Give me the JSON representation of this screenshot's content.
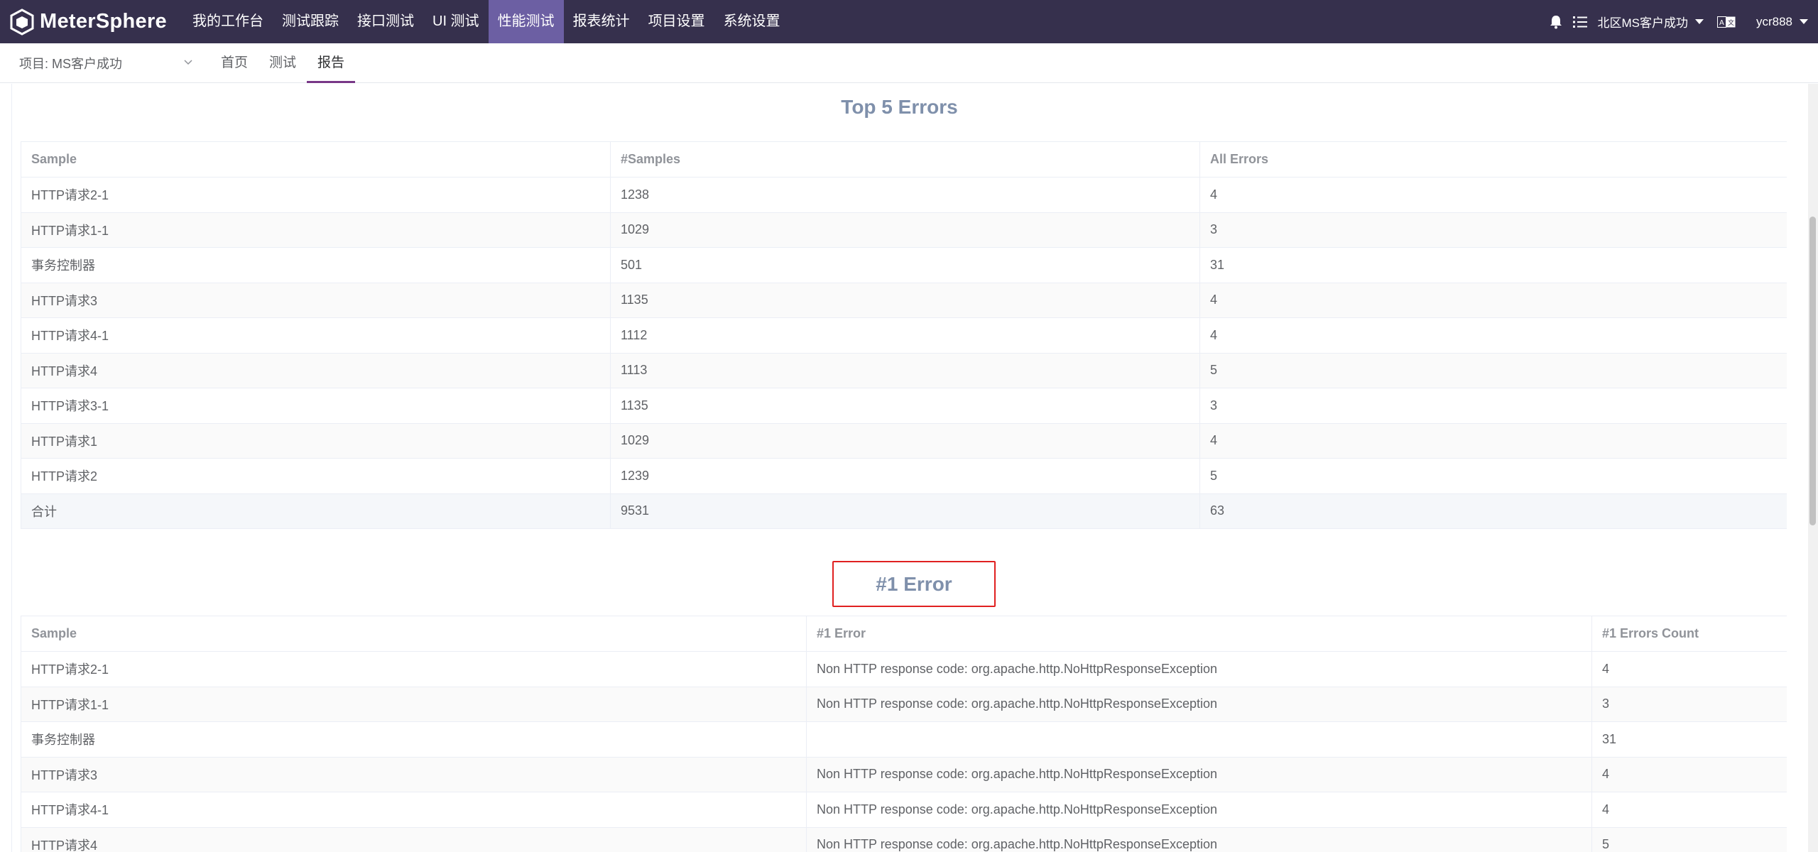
{
  "app": {
    "name": "MeterSphere"
  },
  "nav": {
    "items": [
      {
        "label": "我的工作台",
        "active": false
      },
      {
        "label": "测试跟踪",
        "active": false
      },
      {
        "label": "接口测试",
        "active": false
      },
      {
        "label": "UI 测试",
        "active": false
      },
      {
        "label": "性能测试",
        "active": true
      },
      {
        "label": "报表统计",
        "active": false
      },
      {
        "label": "项目设置",
        "active": false
      },
      {
        "label": "系统设置",
        "active": false
      }
    ]
  },
  "header_right": {
    "notification_icon": "bell-icon",
    "tasks_icon": "task-list-icon",
    "workspace": "北区MS客户成功",
    "language_icon": "translate-icon",
    "user": "ycr888"
  },
  "subbar": {
    "project_label": "项目: MS客户成功",
    "tabs": [
      {
        "label": "首页",
        "active": false
      },
      {
        "label": "测试",
        "active": false
      },
      {
        "label": "报告",
        "active": true
      }
    ]
  },
  "top_errors": {
    "title": "Top 5 Errors",
    "columns": [
      "Sample",
      "#Samples",
      "All Errors"
    ],
    "rows": [
      [
        "HTTP请求2-1",
        "1238",
        "4"
      ],
      [
        "HTTP请求1-1",
        "1029",
        "3"
      ],
      [
        "事务控制器",
        "501",
        "31"
      ],
      [
        "HTTP请求3",
        "1135",
        "4"
      ],
      [
        "HTTP请求4-1",
        "1112",
        "4"
      ],
      [
        "HTTP请求4",
        "1113",
        "5"
      ],
      [
        "HTTP请求3-1",
        "1135",
        "3"
      ],
      [
        "HTTP请求1",
        "1029",
        "4"
      ],
      [
        "HTTP请求2",
        "1239",
        "5"
      ]
    ],
    "total": [
      "合计",
      "9531",
      "63"
    ]
  },
  "error1": {
    "title": "#1 Error",
    "columns": [
      "Sample",
      "#1 Error",
      "#1 Errors Count"
    ],
    "rows": [
      [
        "HTTP请求2-1",
        "Non HTTP response code: org.apache.http.NoHttpResponseException",
        "4"
      ],
      [
        "HTTP请求1-1",
        "Non HTTP response code: org.apache.http.NoHttpResponseException",
        "3"
      ],
      [
        "事务控制器",
        "",
        "31"
      ],
      [
        "HTTP请求3",
        "Non HTTP response code: org.apache.http.NoHttpResponseException",
        "4"
      ],
      [
        "HTTP请求4-1",
        "Non HTTP response code: org.apache.http.NoHttpResponseException",
        "4"
      ],
      [
        "HTTP请求4",
        "Non HTTP response code: org.apache.http.NoHttpResponseException",
        "5"
      ]
    ]
  },
  "colors": {
    "topbar": "#36304d",
    "nav_active": "#6c5fa3",
    "tab_underline": "#783887",
    "highlight_box": "#e02020",
    "section_title": "#7f90ab"
  }
}
